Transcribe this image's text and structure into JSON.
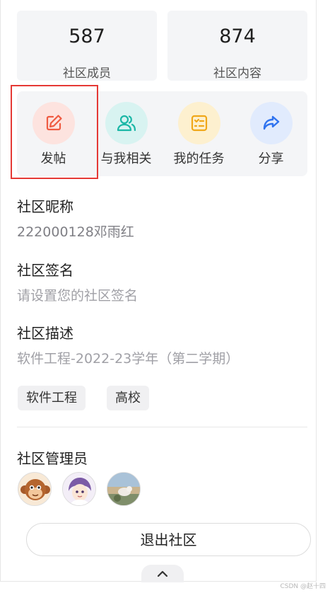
{
  "stats": [
    {
      "value": "587",
      "label": "社区成员"
    },
    {
      "value": "874",
      "label": "社区内容"
    }
  ],
  "actions": [
    {
      "label": "发帖",
      "icon": "edit-icon",
      "bg": "#fde3df",
      "color": "#ef5b42"
    },
    {
      "label": "与我相关",
      "icon": "users-icon",
      "bg": "#d8f3f1",
      "color": "#1bb7a6"
    },
    {
      "label": "我的任务",
      "icon": "task-list-icon",
      "bg": "#fdf0cf",
      "color": "#f0a719"
    },
    {
      "label": "分享",
      "icon": "share-icon",
      "bg": "#e1ebfd",
      "color": "#2f73ef"
    }
  ],
  "profile": {
    "nickname_label": "社区昵称",
    "nickname_value": "222000128邓雨红",
    "signature_label": "社区签名",
    "signature_placeholder": "请设置您的社区签名",
    "description_label": "社区描述",
    "description_value": "软件工程-2022-23学年（第二学期）"
  },
  "tags": [
    "软件工程",
    "高校"
  ],
  "admins": {
    "label": "社区管理员",
    "avatars": [
      "avatar-monkey",
      "avatar-anime-girl",
      "avatar-photo-landscape"
    ]
  },
  "exit_button": "退出社区",
  "watermark": "CSDN @赵十四"
}
